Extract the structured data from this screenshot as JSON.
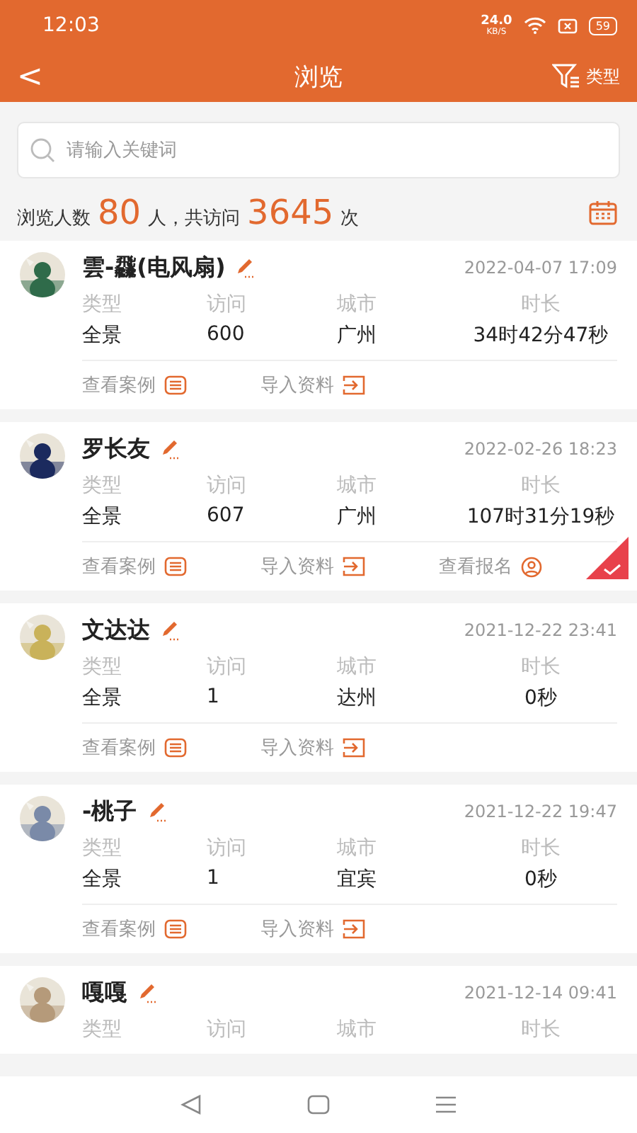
{
  "status_bar": {
    "time": "12:03",
    "speed": "24.0",
    "speed_unit": "KB/S",
    "battery": "59"
  },
  "header": {
    "back": "<",
    "title": "浏览",
    "filter_label": "类型"
  },
  "search": {
    "placeholder": "请输入关键词"
  },
  "summary": {
    "prefix": "浏览人数",
    "people": "80",
    "middle": "人，共访问",
    "visits": "3645",
    "suffix": "次"
  },
  "cards": [
    {
      "name": "雲-飝(电风扇)",
      "date": "2022-04-07 17:09",
      "labels": [
        "类型",
        "访问",
        "城市",
        "时长"
      ],
      "values": [
        "全景",
        "600",
        "广州",
        "34时42分47秒"
      ],
      "checked": false,
      "actions": [
        {
          "kind": "case",
          "label": "查看案例"
        },
        {
          "kind": "import",
          "label": "导入资料"
        }
      ]
    },
    {
      "name": "罗长友",
      "date": "2022-02-26 18:23",
      "labels": [
        "类型",
        "访问",
        "城市",
        "时长"
      ],
      "values": [
        "全景",
        "607",
        "广州",
        "107时31分19秒"
      ],
      "checked": true,
      "actions": [
        {
          "kind": "case",
          "label": "查看案例"
        },
        {
          "kind": "import",
          "label": "导入资料"
        },
        {
          "kind": "signup",
          "label": "查看报名"
        }
      ]
    },
    {
      "name": "文达达",
      "date": "2021-12-22 23:41",
      "labels": [
        "类型",
        "访问",
        "城市",
        "时长"
      ],
      "values": [
        "全景",
        "1",
        "达州",
        "0秒"
      ],
      "checked": false,
      "actions": [
        {
          "kind": "case",
          "label": "查看案例"
        },
        {
          "kind": "import",
          "label": "导入资料"
        }
      ]
    },
    {
      "name": "-桃子",
      "date": "2021-12-22 19:47",
      "labels": [
        "类型",
        "访问",
        "城市",
        "时长"
      ],
      "values": [
        "全景",
        "1",
        "宜宾",
        "0秒"
      ],
      "checked": false,
      "actions": [
        {
          "kind": "case",
          "label": "查看案例"
        },
        {
          "kind": "import",
          "label": "导入资料"
        }
      ]
    },
    {
      "name": "嘎嘎",
      "date": "2021-12-14 09:41",
      "labels": [
        "类型",
        "访问",
        "城市",
        "时长"
      ],
      "checked": false
    }
  ]
}
